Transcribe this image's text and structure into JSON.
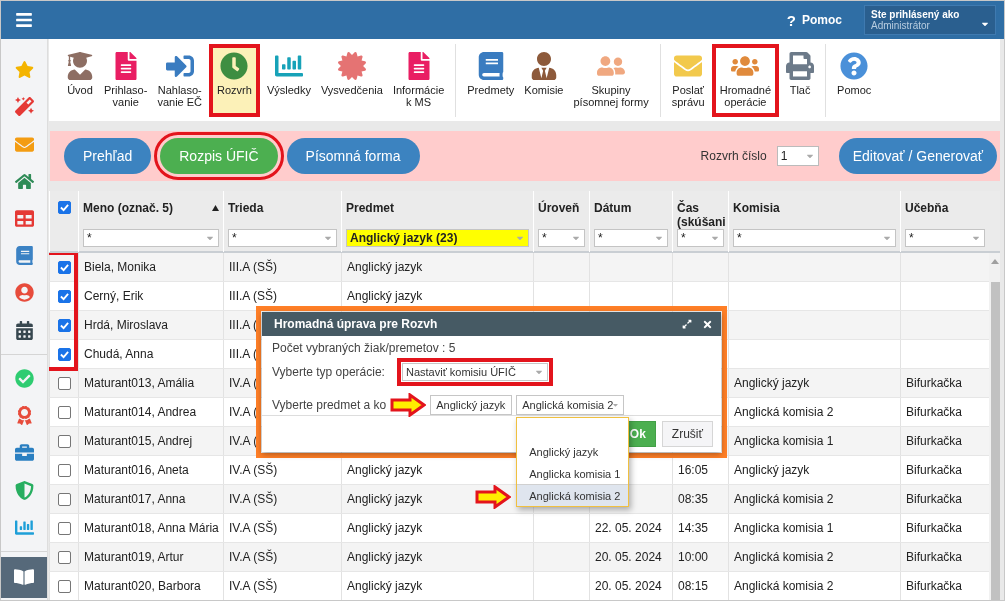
{
  "topbar": {
    "help_mark": "?",
    "help_label": "Pomoc",
    "user_caption": "Ste prihlásený ako",
    "user_name": "Administrátor"
  },
  "toolbar": {
    "groups": [
      [
        {
          "label": "Úvod",
          "selected": false,
          "highlighted": false
        },
        {
          "label": "Prihlaso-\nvanie",
          "selected": false,
          "highlighted": false
        },
        {
          "label": "Nahlaso-\nvanie EČ",
          "selected": false,
          "highlighted": false
        },
        {
          "label": "Rozvrh",
          "selected": true,
          "highlighted": true
        },
        {
          "label": "Výsledky",
          "selected": false,
          "highlighted": false
        },
        {
          "label": "Vysvedčenia",
          "selected": false,
          "highlighted": false
        },
        {
          "label": "Informácie\nk MS",
          "selected": false,
          "highlighted": false
        }
      ],
      [
        {
          "label": "Predmety",
          "selected": false,
          "highlighted": false
        },
        {
          "label": "Komisie",
          "selected": false,
          "highlighted": false
        },
        {
          "label": "Skupiny\npísomnej formy",
          "selected": false,
          "highlighted": false
        }
      ],
      [
        {
          "label": "Poslať\nsprávu",
          "selected": false,
          "highlighted": false
        },
        {
          "label": "Hromadné\noperácie",
          "selected": false,
          "highlighted": true
        },
        {
          "label": "Tlač",
          "selected": false,
          "highlighted": false
        }
      ],
      [
        {
          "label": "Pomoc",
          "selected": false,
          "highlighted": false
        }
      ]
    ]
  },
  "tabs": [
    {
      "label": "Prehľad",
      "selected": false,
      "highlighted": false
    },
    {
      "label": "Rozpis ÚFIČ",
      "selected": true,
      "highlighted": true
    },
    {
      "label": "Písomná forma",
      "selected": false,
      "highlighted": false
    }
  ],
  "schedule": {
    "label": "Rozvrh číslo",
    "value": "1"
  },
  "edit_button": "Editovať / Generovať",
  "table": {
    "select_all": true,
    "columns": [
      {
        "label": "Meno (označ. 5)",
        "sorted": true,
        "filter": "*",
        "filter_active": false
      },
      {
        "label": "Trieda",
        "sorted": false,
        "filter": "*",
        "filter_active": false
      },
      {
        "label": "Predmet",
        "sorted": false,
        "filter": "Anglický jazyk (23)",
        "filter_active": true
      },
      {
        "label": "Úroveň",
        "sorted": false,
        "filter": "*",
        "filter_active": false
      },
      {
        "label": "Dátum",
        "sorted": false,
        "filter": "*",
        "filter_active": false
      },
      {
        "label": "Čas\n(skúšani",
        "sorted": false,
        "filter": "*",
        "filter_active": false
      },
      {
        "label": "Komisia",
        "sorted": false,
        "filter": "*",
        "filter_active": false
      },
      {
        "label": "Učebňa",
        "sorted": false,
        "filter": "*",
        "filter_active": false
      }
    ],
    "rows": [
      {
        "checked": true,
        "highlighted": true,
        "cells": [
          "Biela, Monika",
          "III.A (SŠ)",
          "Anglický jazyk",
          null,
          null,
          null,
          null,
          null
        ]
      },
      {
        "checked": true,
        "highlighted": true,
        "cells": [
          "Cerný, Erik",
          "III.A (SŠ)",
          "Anglický jazyk",
          null,
          null,
          null,
          null,
          null
        ]
      },
      {
        "checked": true,
        "highlighted": true,
        "cells": [
          "Hrdá, Miroslava",
          "III.A (",
          null,
          null,
          null,
          null,
          null,
          null
        ]
      },
      {
        "checked": true,
        "highlighted": true,
        "cells": [
          "Chudá, Anna",
          "III.A (",
          null,
          null,
          null,
          null,
          null,
          null
        ]
      },
      {
        "checked": false,
        "highlighted": false,
        "cells": [
          "Maturant013, Amália",
          "IV.A (",
          null,
          null,
          null,
          null,
          "Anglický jazyk",
          "Bifurkačka"
        ]
      },
      {
        "checked": false,
        "highlighted": false,
        "cells": [
          "Maturant014, Andrea",
          "IV.A (",
          null,
          null,
          null,
          null,
          "Anglická komisia 2",
          "Bifurkačka"
        ]
      },
      {
        "checked": false,
        "highlighted": false,
        "cells": [
          "Maturant015, Andrej",
          "IV.A (",
          null,
          null,
          null,
          null,
          "Anglicka komisia 1",
          "Bifurkačka"
        ]
      },
      {
        "checked": false,
        "highlighted": false,
        "cells": [
          "Maturant016, Aneta",
          "IV.A (SŠ)",
          "Anglický jazyk",
          null,
          null,
          "16:05",
          "Anglický jazyk",
          "Bifurkačka"
        ]
      },
      {
        "checked": false,
        "highlighted": false,
        "cells": [
          "Maturant017, Anna",
          "IV.A (SŠ)",
          "Anglický jazyk",
          null,
          null,
          "08:35",
          "Anglická komisia 2",
          "Bifurkačka"
        ]
      },
      {
        "checked": false,
        "highlighted": false,
        "cells": [
          "Maturant018, Anna Mária",
          "IV.A (SŠ)",
          "Anglický jazyk",
          null,
          "22. 05. 2024",
          "14:35",
          "Anglicka komisia 1",
          "Bifurkačka"
        ]
      },
      {
        "checked": false,
        "highlighted": false,
        "cells": [
          "Maturant019, Artur",
          "IV.A (SŠ)",
          "Anglický jazyk",
          null,
          "20. 05. 2024",
          "10:00",
          "Anglická komisia 2",
          "Bifurkačka"
        ]
      },
      {
        "checked": false,
        "highlighted": false,
        "cells": [
          "Maturant020, Barbora",
          "IV.A (SŠ)",
          "Anglický jazyk",
          null,
          "20. 05. 2024",
          "08:15",
          "Anglická komisia 2",
          "Bifurkačka"
        ]
      }
    ]
  },
  "dialog": {
    "title": "Hromadná úprava pre Rozvh",
    "count_text": "Počet vybraných žiak/premetov : 5",
    "operation_label": "Vyberte typ operácie:",
    "operation_value": "Nastaviť komisiu ÚFIČ",
    "operation_highlighted": true,
    "subject_label": "Vyberte predmet a ko",
    "subject_value": "Anglický jazyk",
    "committee_value": "Anglická komisia 2",
    "committee_options": [
      {
        "selected": false
      },
      {
        "label": "Anglický jazyk",
        "selected": false
      },
      {
        "label": "Anglicka komisia 1",
        "selected": false
      },
      {
        "label": "Anglická komisia 2",
        "selected": true
      }
    ],
    "ok": "Ok",
    "cancel": "Zrušiť"
  }
}
